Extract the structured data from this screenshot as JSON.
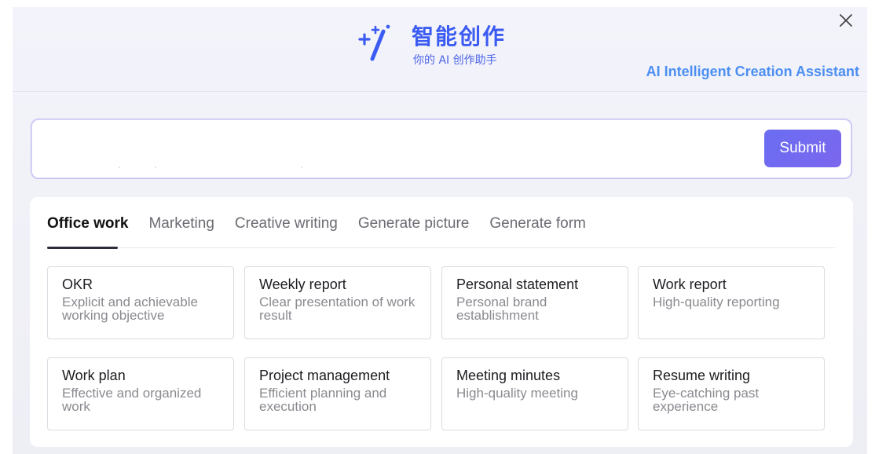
{
  "header": {
    "title": "智能创作",
    "subtitle": "你的 AI 创作助手",
    "assistant_label": "AI Intelligent Creation Assistant",
    "logo_icon": "magic-wand-sparkle-icon",
    "close_icon": "close-icon"
  },
  "prompt": {
    "value": "",
    "placeholder": "",
    "submit_label": "Submit"
  },
  "tabs": [
    {
      "label": "Office work",
      "active": true
    },
    {
      "label": "Marketing",
      "active": false
    },
    {
      "label": "Creative writing",
      "active": false
    },
    {
      "label": "Generate picture",
      "active": false
    },
    {
      "label": "Generate form",
      "active": false
    }
  ],
  "cards": [
    {
      "title": "OKR",
      "desc": "Explicit and achievable working objective"
    },
    {
      "title": "Weekly report",
      "desc": "Clear presentation of work result"
    },
    {
      "title": "Personal statement",
      "desc": "Personal brand establishment"
    },
    {
      "title": "Work report",
      "desc": "High-quality reporting"
    },
    {
      "title": "Work plan",
      "desc": "Effective and organized work"
    },
    {
      "title": "Project management",
      "desc": "Efficient planning and execution"
    },
    {
      "title": "Meeting minutes",
      "desc": "High-quality meeting"
    },
    {
      "title": "Resume writing",
      "desc": "Eye-catching past experience"
    }
  ],
  "colors": {
    "accent": "#3b5bf2",
    "assistant_label": "#4c8ff2",
    "submit_bg": "#6a6df2"
  }
}
